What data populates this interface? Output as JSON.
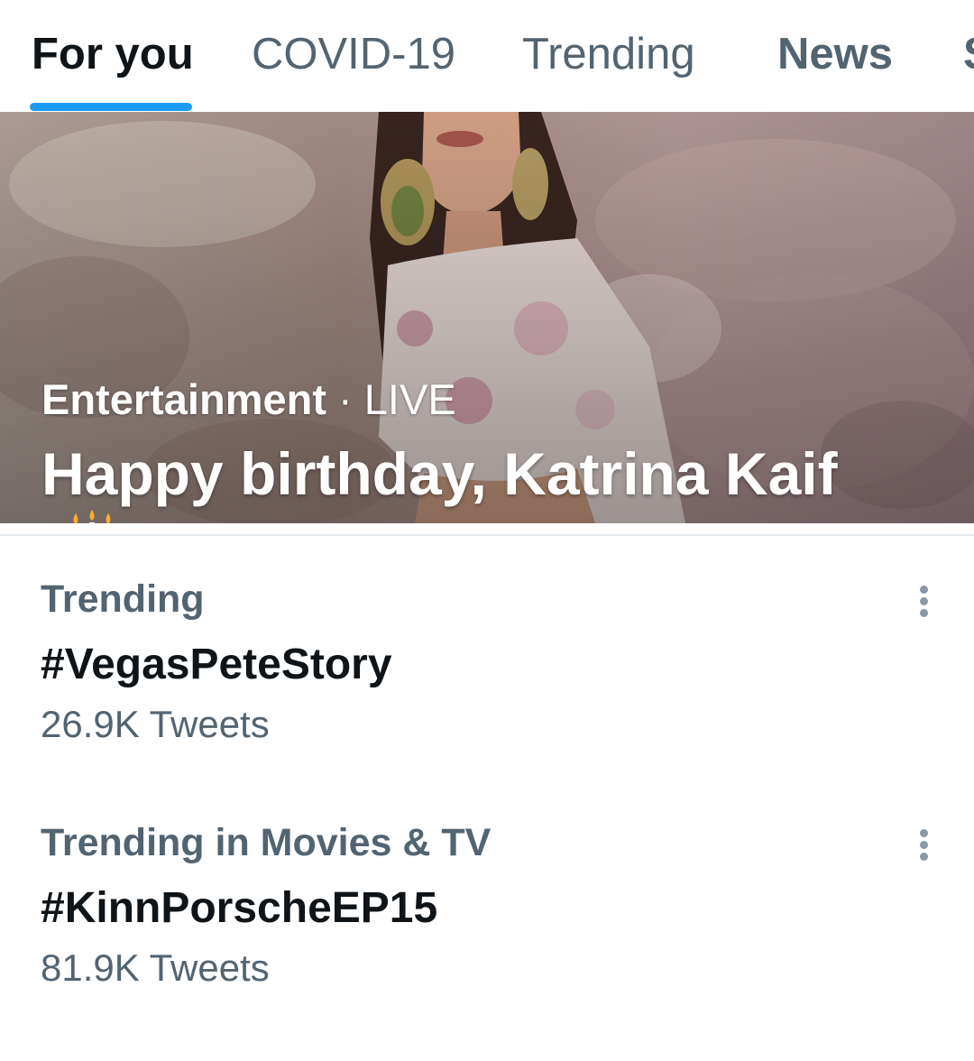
{
  "tabs": [
    {
      "label": "For you",
      "active": true
    },
    {
      "label": "COVID-19",
      "active": false
    },
    {
      "label": "Trending",
      "active": false
    },
    {
      "label": "News",
      "active": false
    },
    {
      "label": "S",
      "active": false
    }
  ],
  "hero": {
    "category": "Entertainment",
    "separator": " · ",
    "status": "LIVE",
    "title": "Happy birthday, Katrina Kaif",
    "emoji_icon": "birthday-cake-icon"
  },
  "trends": [
    {
      "context": "Trending",
      "name": "#VegasPeteStory",
      "count": "26.9K Tweets"
    },
    {
      "context": "Trending in Movies & TV",
      "name": "#KinnPorscheEP15",
      "count": "81.9K Tweets"
    }
  ],
  "colors": {
    "accent": "#1d9bf0",
    "text_primary": "#0f1419",
    "text_secondary": "#536471"
  }
}
